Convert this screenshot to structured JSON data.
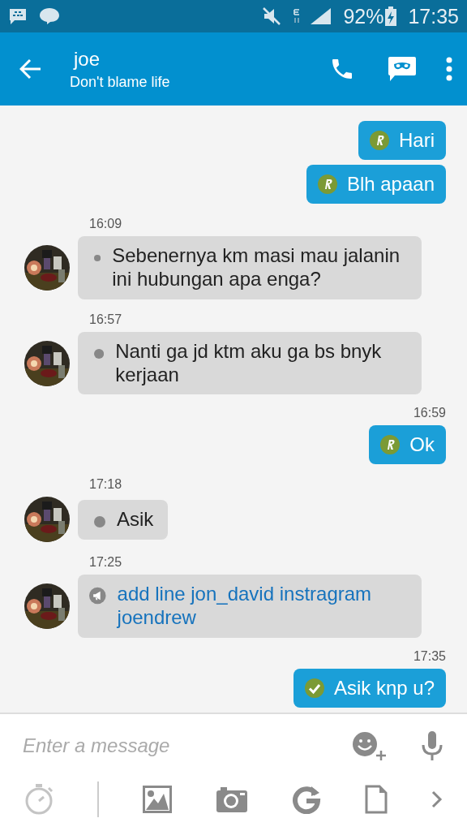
{
  "status_bar": {
    "battery": "92%",
    "time": "17:35"
  },
  "header": {
    "name": "joe",
    "status": "Don't blame life"
  },
  "messages": [
    {
      "kind": "sent_read",
      "text": "Hari"
    },
    {
      "kind": "sent_read",
      "text": "Blh apaan"
    },
    {
      "kind": "received",
      "time": "16:09",
      "text": "Sebenernya km masi mau jalanin ini hubungan apa enga?"
    },
    {
      "kind": "received",
      "time": "16:57",
      "text": "Nanti ga jd ktm aku ga bs bnyk kerjaan"
    },
    {
      "kind": "sent_read",
      "time": "16:59",
      "text": "Ok"
    },
    {
      "kind": "received",
      "time": "17:18",
      "text": "Asik"
    },
    {
      "kind": "received_broadcast",
      "time": "17:25",
      "text": "add line jon_david instragram joendrew"
    },
    {
      "kind": "sent_delivered",
      "time": "17:35",
      "text": "Asik knp u?"
    }
  ],
  "composer": {
    "placeholder": "Enter a message"
  }
}
